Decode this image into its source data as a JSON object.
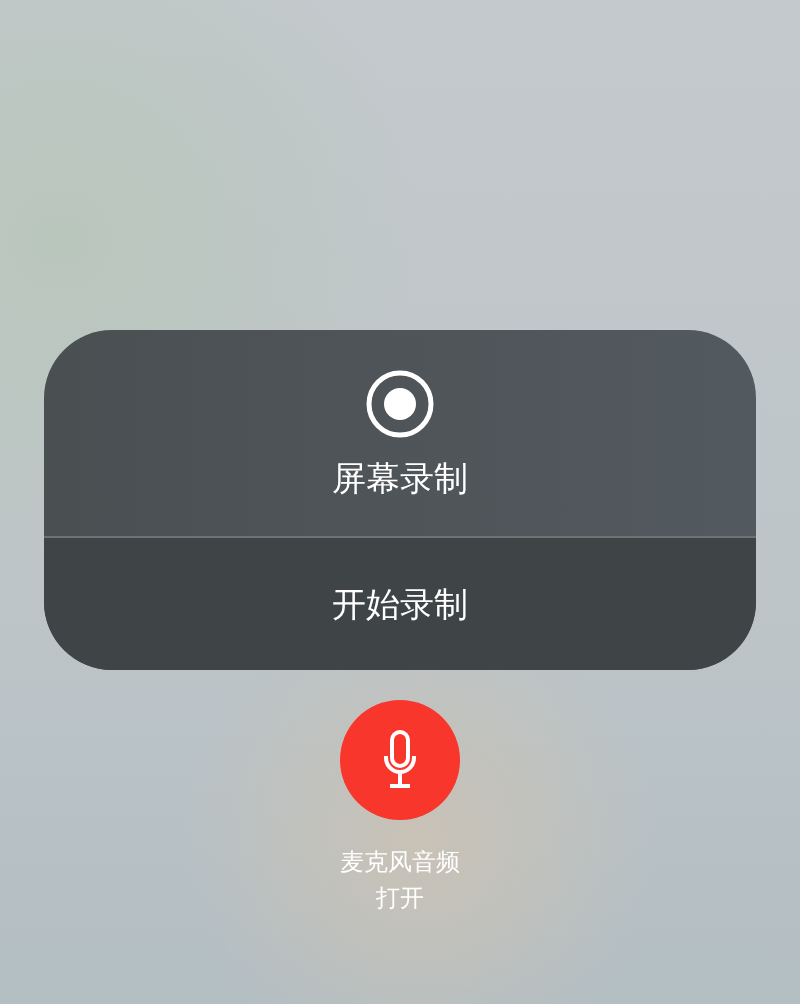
{
  "recording": {
    "title": "屏幕录制",
    "action": "开始录制"
  },
  "microphone": {
    "label": "麦克风音频",
    "status": "打开",
    "on": true
  }
}
